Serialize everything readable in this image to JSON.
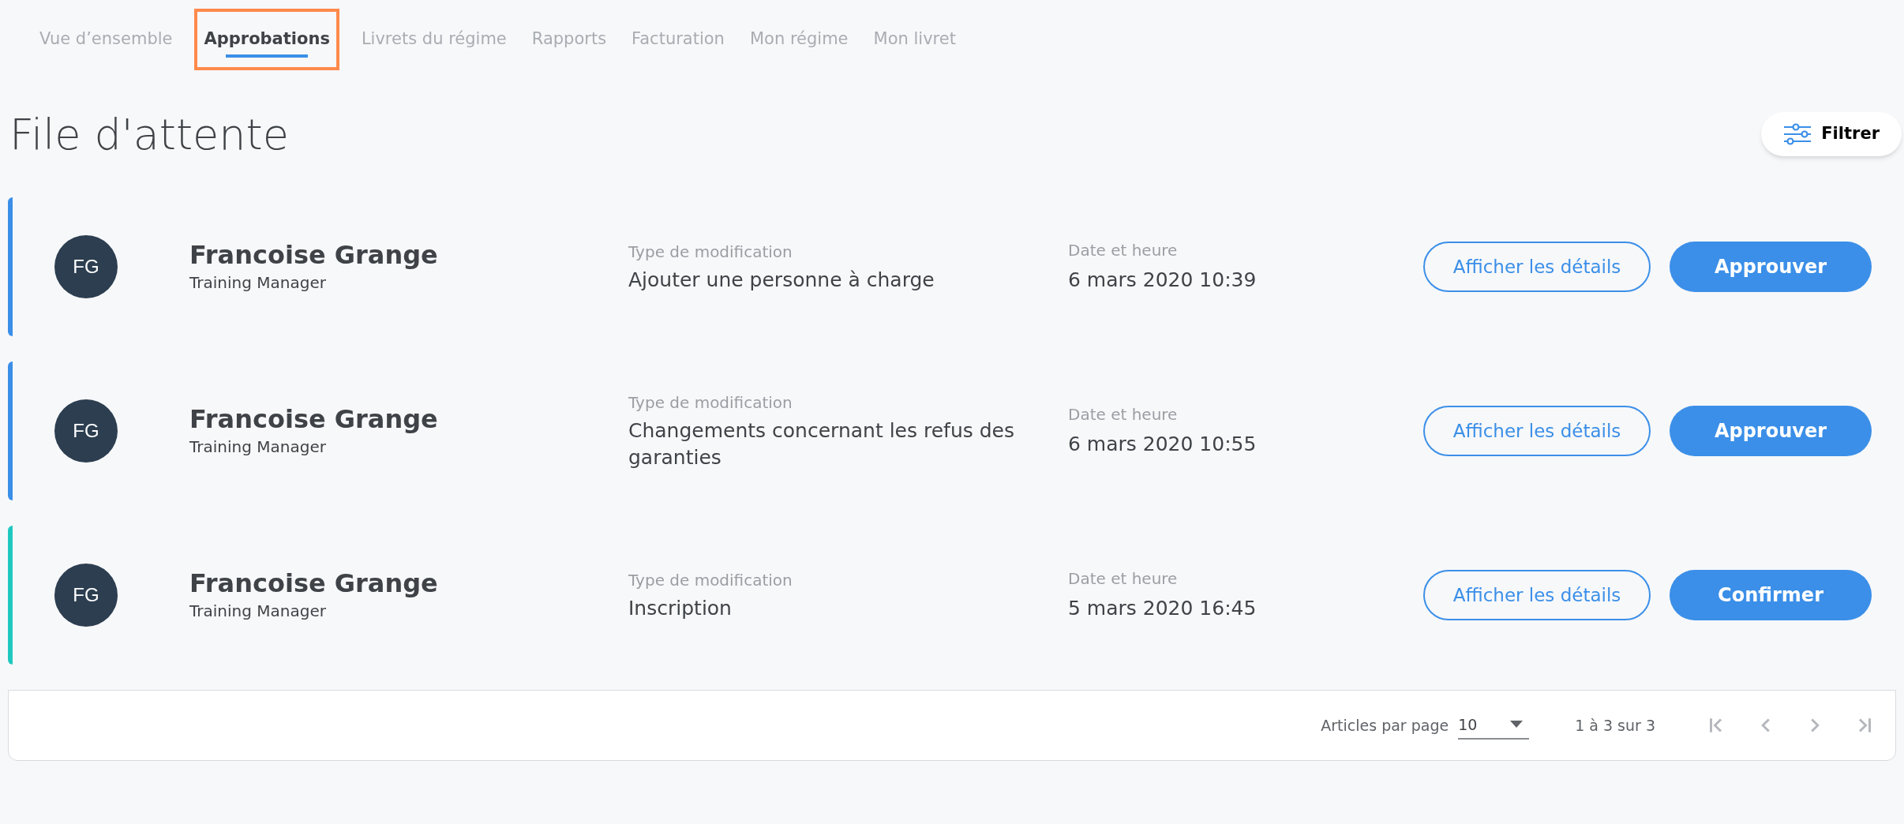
{
  "tabs": [
    {
      "label": "Vue d’ensemble",
      "selected": false
    },
    {
      "label": "Approbations",
      "selected": true
    },
    {
      "label": "Livrets du régime",
      "selected": false
    },
    {
      "label": "Rapports",
      "selected": false
    },
    {
      "label": "Facturation",
      "selected": false
    },
    {
      "label": "Mon régime",
      "selected": false
    },
    {
      "label": "Mon livret",
      "selected": false
    }
  ],
  "page_title": "File d'attente",
  "filter_button": "Filtrer",
  "requests": [
    {
      "color": "#3b8fe8",
      "initials": "FG",
      "name": "Francoise Grange",
      "role": "Training Manager",
      "type_label": "Type de modification",
      "type": "Ajouter une personne à charge",
      "date_label": "Date et heure",
      "date": "6 mars 2020 10:39",
      "details_button": "Afficher les détails",
      "action_button": "Approuver"
    },
    {
      "color": "#3b8fe8",
      "initials": "FG",
      "name": "Francoise Grange",
      "role": "Training Manager",
      "type_label": "Type de modification",
      "type": "Changements concernant les refus des garanties",
      "date_label": "Date et heure",
      "date": "6 mars 2020 10:55",
      "details_button": "Afficher les détails",
      "action_button": "Approuver"
    },
    {
      "color": "#20c9c0",
      "initials": "FG",
      "name": "Francoise Grange",
      "role": "Training Manager",
      "type_label": "Type de modification",
      "type": "Inscription",
      "date_label": "Date et heure",
      "date": "5 mars 2020 16:45",
      "details_button": "Afficher les détails",
      "action_button": "Confirmer"
    }
  ],
  "pagination": {
    "per_page_label": "Articles par page",
    "per_page": "10",
    "range": "1 à 3 sur 3"
  }
}
